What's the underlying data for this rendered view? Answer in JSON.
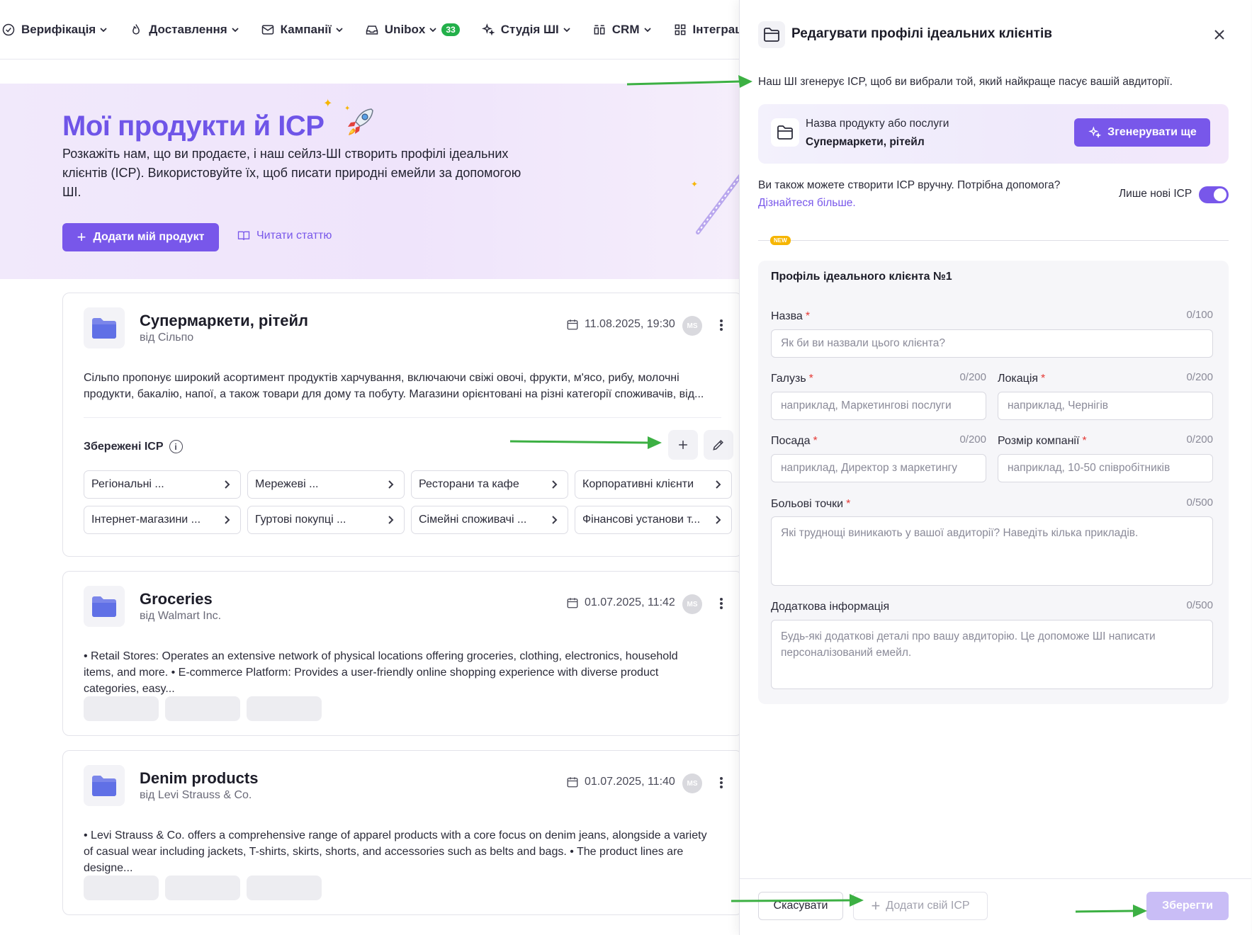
{
  "nav": {
    "items": [
      {
        "label": "Верифікація",
        "icon": "check-circle-icon"
      },
      {
        "label": "Доставлення",
        "icon": "flame-icon"
      },
      {
        "label": "Кампанії",
        "icon": "mail-icon"
      },
      {
        "label": "Unibox",
        "icon": "inbox-icon",
        "badge": "33"
      },
      {
        "label": "Студія ШІ",
        "icon": "sparkles-icon"
      },
      {
        "label": "CRM",
        "icon": "crm-icon"
      },
      {
        "label": "Інтеграції",
        "icon": "grid-icon"
      }
    ]
  },
  "hero": {
    "title": "Мої продукти й ICP",
    "description": "Розкажіть нам, що ви продаєте, і наш сейлз-ШІ створить профілі ідеальних клієнтів (ICP). Використовуйте їх, щоб писати природні емейли за допомогою ШІ.",
    "add_button": "Додати мій продукт",
    "read_link": "Читати статтю"
  },
  "products": [
    {
      "title": "Супермаркети, рітейл",
      "by": "від Сільпо",
      "date": "11.08.2025, 19:30",
      "avatar": "MS",
      "description": "Сільпо пропонує широкий асортимент продуктів харчування, включаючи свіжі овочі, фрукти, м'ясо, рибу, молочні продукти, бакалію, напої, а також товари для дому та побуту. Магазини орієнтовані на різні категорії споживачів, від...",
      "saved_label": "Збережені ICP",
      "icps": [
        "Регіональні ...",
        "Мережеві ...",
        "Ресторани та кафе",
        "Корпоративні клієнти",
        "Інтернет-магазини ...",
        "Гуртові покупці ...",
        "Сімейні споживачі ...",
        "Фінансові установи т..."
      ]
    },
    {
      "title": "Groceries",
      "by": "від Walmart Inc.",
      "date": "01.07.2025, 11:42",
      "avatar": "MS",
      "description": "• Retail Stores: Operates an extensive network of physical locations offering groceries, clothing, electronics, household items, and more. • E-commerce Platform: Provides a user-friendly online shopping experience with diverse product categories, easy..."
    },
    {
      "title": "Denim products",
      "by": "від Levi Strauss & Co.",
      "date": "01.07.2025, 11:40",
      "avatar": "MS",
      "description": "• Levi Strauss & Co. offers a comprehensive range of apparel products with a core focus on denim jeans, alongside a variety of casual wear including jackets, T-shirts, skirts, shorts, and accessories such as belts and bags. • The product lines are designe..."
    }
  ],
  "panel": {
    "title": "Редагувати профілі ідеальних клієнтів",
    "intro": "Наш ШІ згенерує ICP, щоб ви вибрали той, який найкраще пасує вашій авдиторії.",
    "product_label": "Назва продукту або послуги",
    "product_value": "Супермаркети, рітейл",
    "generate_button": "Згенерувати ще",
    "manual_text": "Ви також можете створити ICP вручну. Потрібна допомога?",
    "learn_more": "Дізнайтеся більше.",
    "toggle_label": "Лише нові ICP",
    "new_badge": "NEW",
    "form": {
      "title": "Профіль ідеального клієнта №1",
      "name": {
        "label": "Назва",
        "count": "0/100",
        "placeholder": "Як би ви назвали цього клієнта?"
      },
      "industry": {
        "label": "Галузь",
        "count": "0/200",
        "placeholder": "наприклад, Маркетингові послуги"
      },
      "location": {
        "label": "Локація",
        "count": "0/200",
        "placeholder": "наприклад, Чернігів"
      },
      "position": {
        "label": "Посада",
        "count": "0/200",
        "placeholder": "наприклад, Директор з маркетингу"
      },
      "company_size": {
        "label": "Розмір компанії",
        "count": "0/200",
        "placeholder": "наприклад, 10-50 співробітників"
      },
      "pain_points": {
        "label": "Больові точки",
        "count": "0/500",
        "placeholder": "Які труднощі виникають у вашої авдиторії? Наведіть кілька прикладів."
      },
      "extra": {
        "label": "Додаткова інформація",
        "count": "0/500",
        "placeholder": "Будь-які додаткові деталі про вашу авдиторію. Це допоможе ШІ написати персоналізований емейл."
      }
    },
    "footer": {
      "cancel": "Скасувати",
      "add_icp": "Додати свій ICP",
      "save": "Зберегти"
    }
  },
  "colors": {
    "accent": "#7857ea",
    "annotation_arrow": "#3cb043",
    "badge_green": "#23b04a",
    "new_badge": "#f6b500"
  }
}
